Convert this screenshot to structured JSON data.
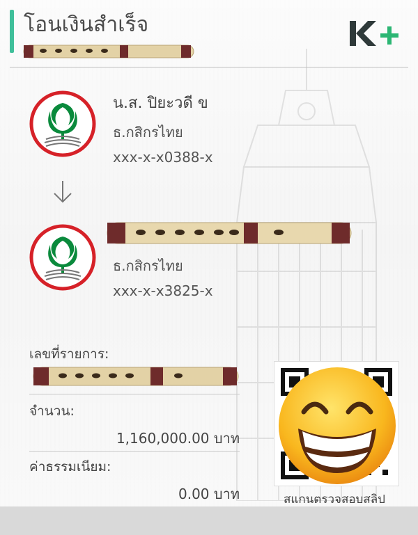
{
  "header": {
    "title": "โอนเงินสำเร็จ",
    "logo_text": "K+",
    "accent_color": "#3fbf9a"
  },
  "sender": {
    "name": "น.ส. ปิยะวดี ข",
    "bank": "ธ.กสิกรไทย",
    "account": "xxx-x-x0388-x",
    "logo_icon": "kbank-logo-icon"
  },
  "receiver": {
    "bank": "ธ.กสิกรไทย",
    "account": "xxx-x-x3825-x",
    "logo_icon": "kbank-logo-icon"
  },
  "details": {
    "ref_label": "เลขที่รายการ:",
    "amount_label": "จำนวน:",
    "amount_value": "1,160,000.00 บาท",
    "fee_label": "ค่าธรรมเนียม:",
    "fee_value": "0.00 บาท"
  },
  "qr": {
    "caption": "สแกนตรวจสอบสลิป",
    "icon": "qr-code-icon",
    "overlay_icon": "grinning-face-emoji-icon"
  },
  "colors": {
    "kbank_green": "#0a8a3c",
    "kbank_red": "#d62128",
    "logo_dark": "#2f3a3a",
    "logo_green": "#2bb673"
  }
}
